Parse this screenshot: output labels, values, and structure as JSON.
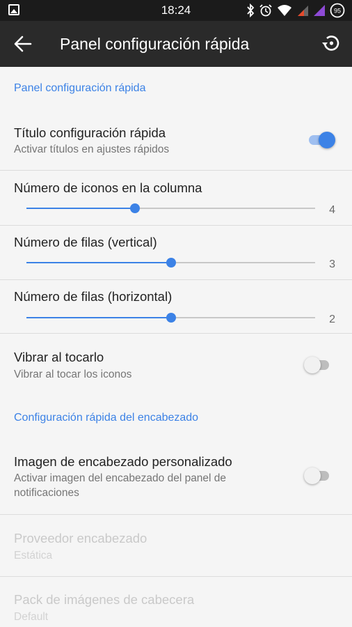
{
  "status_bar": {
    "time": "18:24",
    "battery": "95",
    "icons": [
      "image-icon",
      "bluetooth-icon",
      "alarm-icon",
      "wifi-icon",
      "mobile-signal-icon",
      "signal-icon",
      "battery-icon"
    ]
  },
  "app_bar": {
    "title": "Panel configuración rápida",
    "back_icon": "back-arrow-icon",
    "reset_icon": "restore-icon"
  },
  "colors": {
    "accent": "#3c82e6",
    "app_bar": "#2a2a2a",
    "status_bar": "#1b1b1b",
    "background": "#f5f5f5"
  },
  "sections": [
    {
      "header": "Panel configuración rápida"
    },
    {
      "header": "Configuración rápida del encabezado"
    }
  ],
  "prefs": {
    "quick_titles": {
      "title": "Título configuración rápida",
      "summary": "Activar títulos en ajustes rápidos",
      "enabled": true
    },
    "icons_column": {
      "title": "Número de iconos en la columna",
      "value": "4",
      "fraction": 0.375
    },
    "rows_vertical": {
      "title": "Número de filas (vertical)",
      "value": "3",
      "fraction": 0.5
    },
    "rows_horizontal": {
      "title": "Número de filas (horizontal)",
      "value": "2",
      "fraction": 0.5
    },
    "vibrate": {
      "title": "Vibrar al tocarlo",
      "summary": "Vibrar al tocar los iconos",
      "enabled": false
    },
    "custom_header": {
      "title": "Imagen de encabezado personalizado",
      "summary": "Activar imagen del encabezado del panel de notificaciones",
      "enabled": false
    },
    "header_provider": {
      "title": "Proveedor encabezado",
      "summary": "Estática"
    },
    "header_pack": {
      "title": "Pack de imágenes de cabecera",
      "summary": "Default"
    }
  }
}
